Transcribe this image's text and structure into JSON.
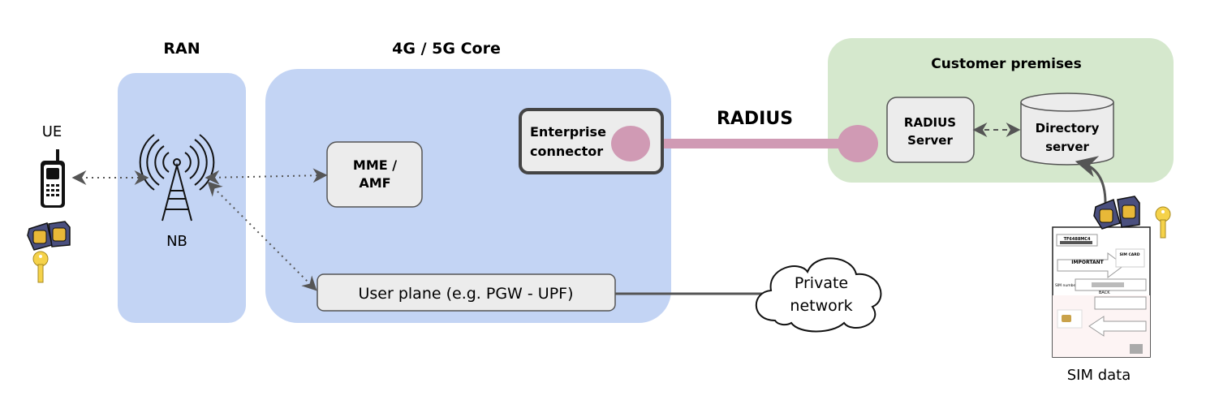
{
  "colors": {
    "ran_bg": "#c3d4f4",
    "core_bg": "#c3d4f4",
    "customer_bg": "#d5e8cd",
    "node_fill": "#ececec",
    "node_border": "#555555",
    "radius_link": "#d09ab4",
    "sim_blue": "#4a4f7e",
    "sim_gold": "#e8b838",
    "key_yellow": "#f5d24a"
  },
  "labels": {
    "ue": "UE",
    "ran": "RAN",
    "nb": "NB",
    "core": "4G / 5G Core",
    "mme_line1": "MME /",
    "mme_line2": "AMF",
    "enterprise_line1": "Enterprise",
    "enterprise_line2": "connector",
    "user_plane": "User plane (e.g. PGW - UPF)",
    "radius": "RADIUS",
    "customer": "Customer premises",
    "radius_server_line1": "RADIUS",
    "radius_server_line2": "Server",
    "directory_line1": "Directory",
    "directory_line2": "server",
    "private_line1": "Private",
    "private_line2": "network",
    "sim_data": "SIM data"
  },
  "sim_card_image_text": [
    "TF6488MC4",
    "IMPORTANT",
    "SIM CARD",
    "SIM number",
    "BACK"
  ],
  "icons": [
    "mobile-phone-icon",
    "sim-card-icon",
    "key-icon",
    "cell-tower-icon",
    "cloud-icon",
    "database-icon"
  ]
}
